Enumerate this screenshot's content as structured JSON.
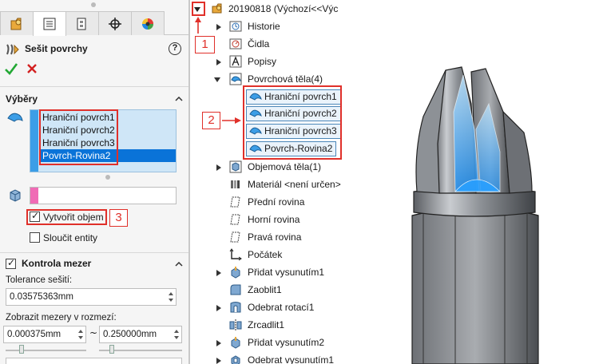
{
  "pm": {
    "title": "Sešit povrchy",
    "help": "?",
    "selections_section": "Výběry",
    "selections": [
      "Hraniční povrch1",
      "Hraniční povrch2",
      "Hraniční povrch3",
      "Povrch-Rovina2"
    ],
    "selected_index": 3,
    "create_solid_label": "Vytvořit objem",
    "create_solid_checked": true,
    "merge_entities_label": "Sloučit entity",
    "merge_entities_checked": false,
    "gap_section": "Kontrola mezer",
    "gap_checked": true,
    "tolerance_label": "Tolerance sešití:",
    "tolerance_value": "0.03575363mm",
    "gap_range_label": "Zobrazit mezery v rozmezí:",
    "gap_min": "0.000375mm",
    "gap_tilde": "~",
    "gap_max": "0.250000mm"
  },
  "callouts": {
    "one": "1",
    "two": "2",
    "three": "3"
  },
  "tree": {
    "root": "20190818  (Výchozí<<Výc",
    "items": {
      "history": "Historie",
      "sensors": "Čidla",
      "annotations": "Popisy",
      "surface_bodies": "Povrchová těla(4)",
      "solid_bodies": "Objemová těla(1)",
      "material": "Materiál <není určen>",
      "front_plane": "Přední rovina",
      "top_plane": "Horní rovina",
      "right_plane": "Pravá rovina",
      "origin": "Počátek",
      "extrude1": "Přidat vysunutím1",
      "fillet1": "Zaoblit1",
      "revolve_cut1": "Odebrat rotací1",
      "mirror1": "Zrcadlit1",
      "extrude2": "Přidat vysunutím2",
      "cut_extrude1": "Odebrat vysunutím1"
    },
    "surfaces": [
      "Hraniční povrch1",
      "Hraniční povrch2",
      "Hraniční povrch3",
      "Povrch-Rovina2"
    ]
  },
  "colors": {
    "accent_blue": "#0a73d8",
    "selection_bar": "#3c9ee7",
    "body_bar": "#f06bb5",
    "callout_red": "#e0302a"
  }
}
